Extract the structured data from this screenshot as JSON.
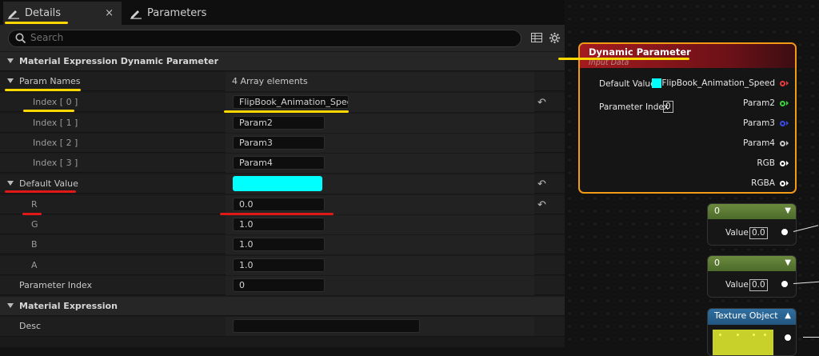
{
  "tabs": [
    {
      "label": "Details",
      "close": "×"
    },
    {
      "label": "Parameters"
    }
  ],
  "search": {
    "placeholder": "Search"
  },
  "sections": {
    "dyn_param": "Material Expression Dynamic Parameter",
    "mat_expr": "Material Expression"
  },
  "param_names": {
    "label": "Param Names",
    "value": "4 Array elements"
  },
  "indices": [
    {
      "label": "Index [ 0 ]",
      "value": "FlipBook_Animation_Speed"
    },
    {
      "label": "Index [ 1 ]",
      "value": "Param2"
    },
    {
      "label": "Index [ 2 ]",
      "value": "Param3"
    },
    {
      "label": "Index [ 3 ]",
      "value": "Param4"
    }
  ],
  "default_value": {
    "label": "Default Value",
    "color": "#00ffff"
  },
  "channels": [
    {
      "label": "R",
      "value": "0.0"
    },
    {
      "label": "G",
      "value": "1.0"
    },
    {
      "label": "B",
      "value": "1.0"
    },
    {
      "label": "A",
      "value": "1.0"
    }
  ],
  "parameter_index": {
    "label": "Parameter Index",
    "value": "0"
  },
  "desc": {
    "label": "Desc",
    "value": ""
  },
  "icons": {
    "reset": "reset-arrow-icon",
    "grid": "grid-icon",
    "settings": "gear-icon",
    "edit": "pencil-icon"
  },
  "graph": {
    "dyn_node": {
      "title": "Dynamic Parameter",
      "subtitle": "Input Data",
      "default_value_label": "Default Value",
      "parameter_index_label": "Parameter Index",
      "parameter_index_value": "0",
      "outputs": [
        {
          "label": "FlipBook_Animation_Speed",
          "color": "#e83a3a"
        },
        {
          "label": "Param2",
          "color": "#3ad13a"
        },
        {
          "label": "Param3",
          "color": "#3a4ae8"
        },
        {
          "label": "Param4",
          "color": "#c8c8c8"
        },
        {
          "label": "RGB",
          "color": "#ffffff"
        },
        {
          "label": "RGBA",
          "color": "#ffffff"
        }
      ]
    },
    "const_nodes": [
      {
        "title": "0",
        "value_label": "Value",
        "value": "0.0"
      },
      {
        "title": "0",
        "value_label": "Value",
        "value": "0.0"
      }
    ],
    "texture_node": {
      "title": "Texture Object"
    }
  }
}
